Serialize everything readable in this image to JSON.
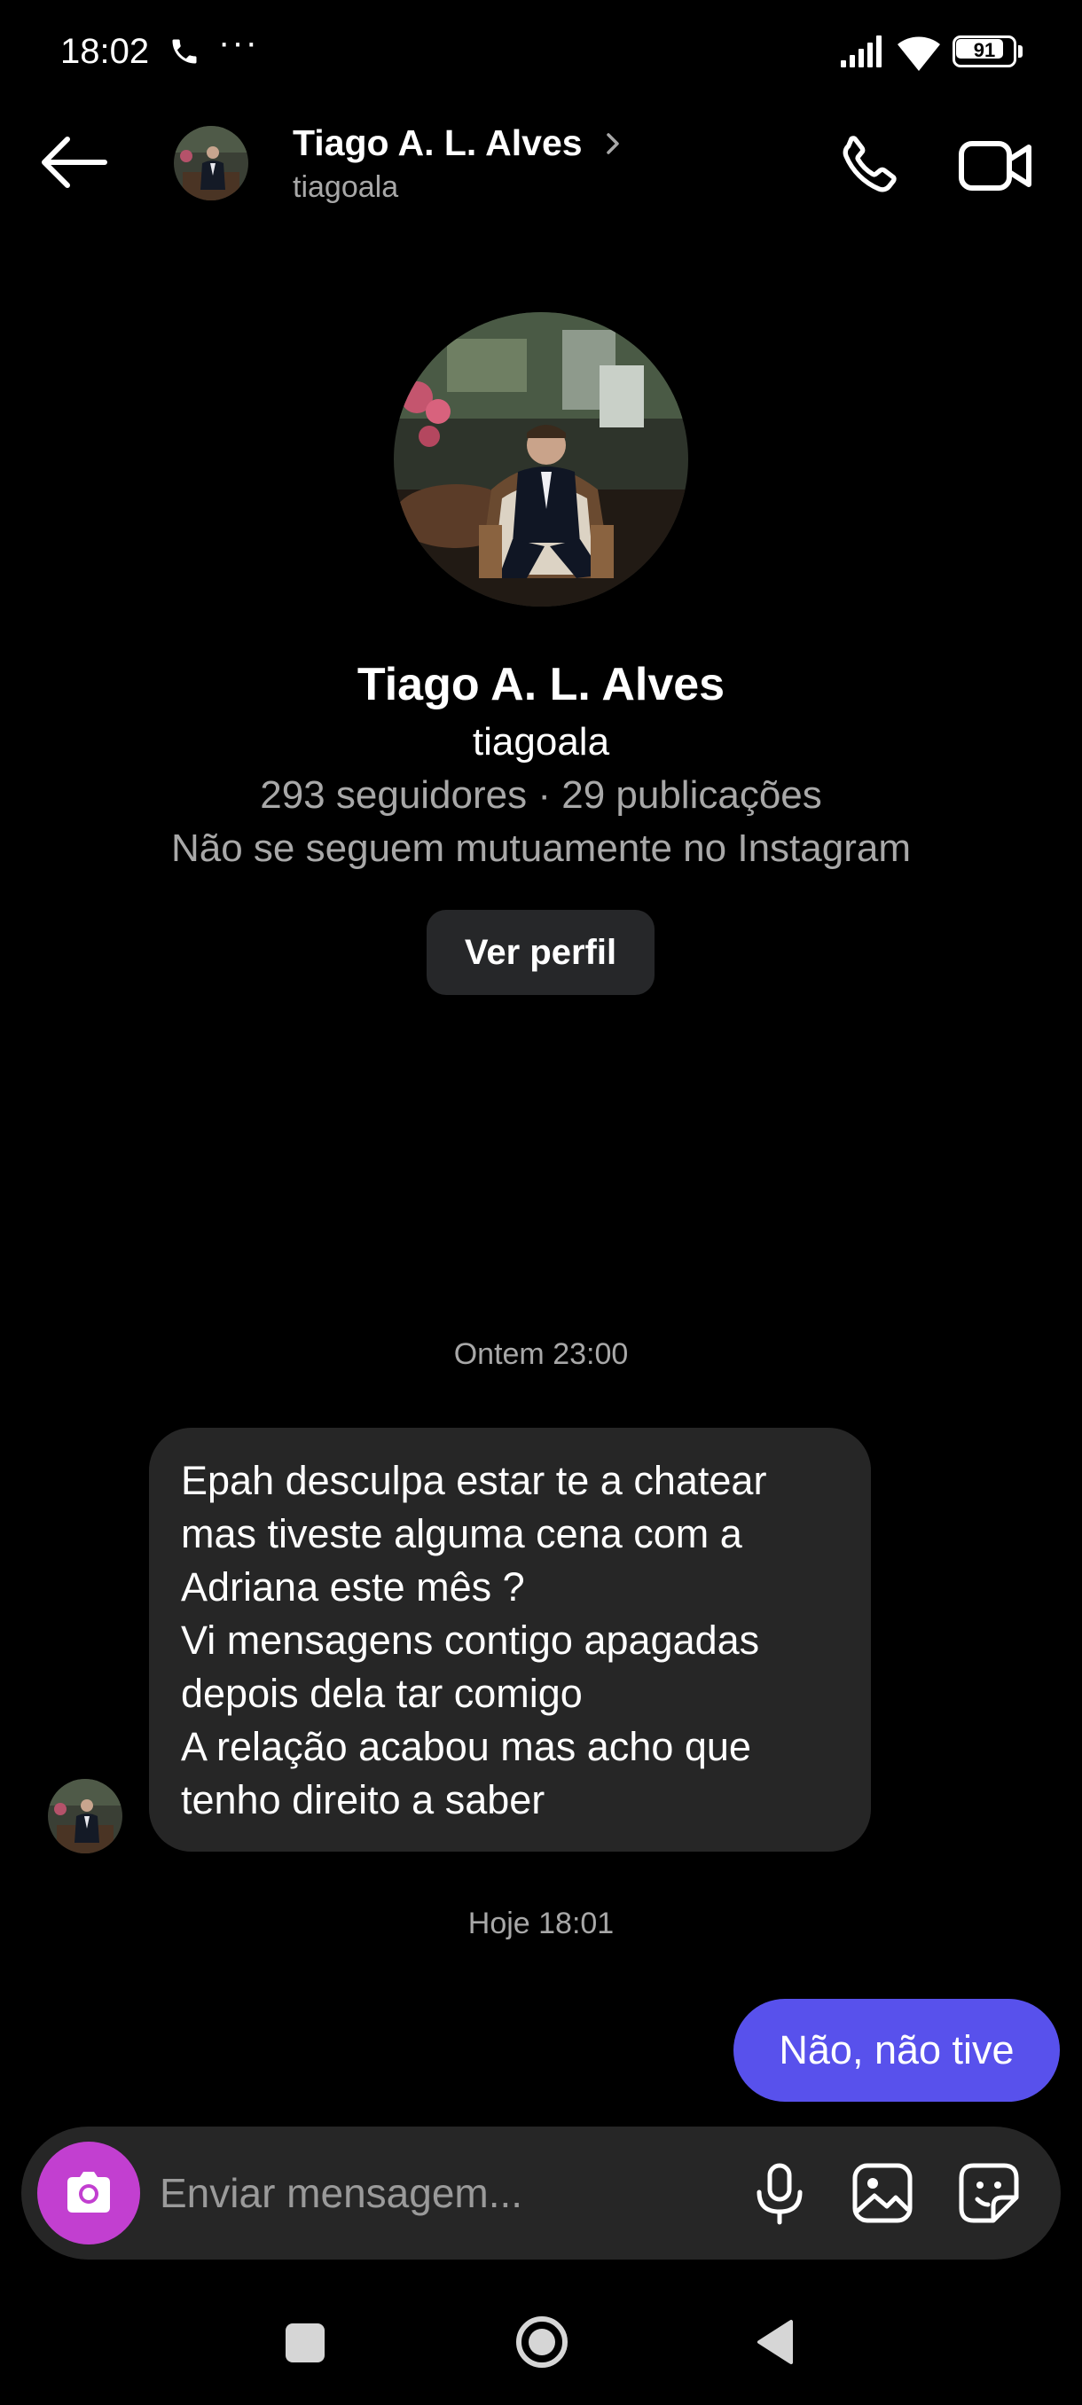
{
  "status_bar": {
    "time": "18:02",
    "dots": "···",
    "battery_level": "91",
    "battery_fraction": 0.91
  },
  "header": {
    "name": "Tiago A. L. Alves",
    "username": "tiagoala",
    "icons": {
      "back": "arrow-left-icon",
      "chevron": "chevron-right-icon",
      "call": "phone-icon",
      "video": "video-camera-icon"
    }
  },
  "profile": {
    "name": "Tiago A. L. Alves",
    "username": "tiagoala",
    "stats": "293 seguidores · 29 publicações",
    "mutual": "Não se seguem mutuamente no Instagram",
    "view_profile_label": "Ver perfil"
  },
  "messages": {
    "timestamp_1": "Ontem 23:00",
    "incoming_lines": [
      "Epah desculpa estar te a chatear",
      "mas tiveste alguma cena com a",
      "Adriana este mês ?",
      "Vi mensagens contigo apagadas",
      "depois dela tar comigo",
      "A relação acabou mas acho que",
      "tenho direito a saber"
    ],
    "timestamp_2": "Hoje 18:01",
    "outgoing": "Não, não tive"
  },
  "composer": {
    "placeholder": "Enviar mensagem...",
    "icons": {
      "camera": "camera-icon",
      "mic": "microphone-icon",
      "gallery": "image-icon",
      "sticker": "sticker-icon"
    }
  },
  "colors": {
    "background": "#000000",
    "bubble_incoming": "#262626",
    "bubble_outgoing": "#5851ec",
    "camera_button": "#c23fd0",
    "secondary_text": "#a8a8a8"
  }
}
